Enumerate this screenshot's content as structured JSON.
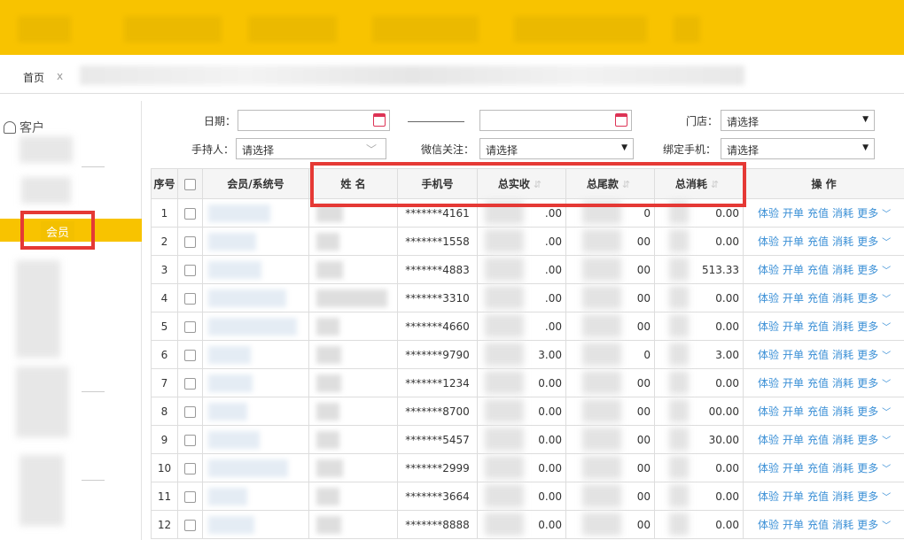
{
  "tabs": {
    "home": "首页",
    "close": "x"
  },
  "sidebar": {
    "title": "客户",
    "active_item": "会员"
  },
  "filters": {
    "date_label": "日期：",
    "holder_label": "手持人：",
    "holder_value": "请选择",
    "wechat_label": "微信关注：",
    "wechat_value": "请选择",
    "store_label": "门店：",
    "store_value": "请选择",
    "phone_bind_label": "绑定手机：",
    "phone_bind_value": "请选择"
  },
  "table": {
    "headers": {
      "idx": "序号",
      "member": "会员/系统号",
      "name": "姓 名",
      "phone": "手机号",
      "total_received": "总实收",
      "total_balance": "总尾款",
      "total_consumed": "总消耗",
      "ops": "操 作"
    },
    "ops_labels": [
      "体验",
      "开单",
      "充值",
      "消耗",
      "更多"
    ],
    "rows": [
      {
        "idx": "1",
        "phone": "*******4161",
        "received": ".00",
        "balance": "0",
        "consumed": "0.00"
      },
      {
        "idx": "2",
        "phone": "*******1558",
        "received": ".00",
        "balance": "00",
        "consumed": "0.00"
      },
      {
        "idx": "3",
        "phone": "*******4883",
        "received": ".00",
        "balance": "00",
        "consumed": "513.33"
      },
      {
        "idx": "4",
        "phone": "*******3310",
        "received": ".00",
        "balance": "00",
        "consumed": "0.00"
      },
      {
        "idx": "5",
        "phone": "*******4660",
        "received": ".00",
        "balance": "00",
        "consumed": "0.00"
      },
      {
        "idx": "6",
        "phone": "*******9790",
        "received": "3.00",
        "balance": "0",
        "consumed": "3.00"
      },
      {
        "idx": "7",
        "phone": "*******1234",
        "received": "0.00",
        "balance": "00",
        "consumed": "0.00"
      },
      {
        "idx": "8",
        "phone": "*******8700",
        "received": "0.00",
        "balance": "00",
        "consumed": "00.00"
      },
      {
        "idx": "9",
        "phone": "*******5457",
        "received": "0.00",
        "balance": "00",
        "consumed": "30.00"
      },
      {
        "idx": "10",
        "phone": "*******2999",
        "received": "0.00",
        "balance": "00",
        "consumed": "0.00"
      },
      {
        "idx": "11",
        "phone": "*******3664",
        "received": "0.00",
        "balance": "00",
        "consumed": "0.00"
      },
      {
        "idx": "12",
        "phone": "*******8888",
        "received": "0.00",
        "balance": "00",
        "consumed": "0.00"
      }
    ]
  },
  "colors": {
    "brand_yellow": "#f8c300",
    "highlight_red": "#e53935",
    "link_blue": "#3a8fd6"
  },
  "icons": [
    "user-icon",
    "calendar-icon",
    "dropdown-caret-icon",
    "chevron-down-icon",
    "sort-icon",
    "more-chevron-icon"
  ]
}
